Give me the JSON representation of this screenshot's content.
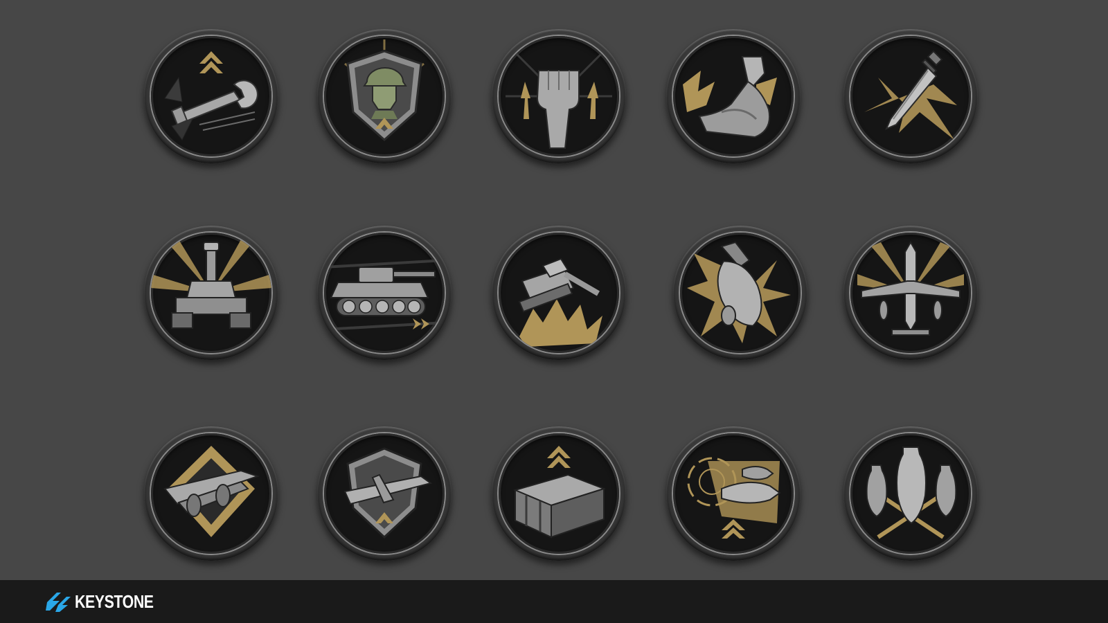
{
  "footer": {
    "brand": "KEYSTONE",
    "accent_color": "#2aa7e8"
  },
  "palette": {
    "background": "#474747",
    "gold": "#b09558",
    "steel": "#9a9a9a",
    "olive": "#7f8c64"
  },
  "icons": [
    {
      "name": "wrench-upgrade-icon",
      "motif": "wrench"
    },
    {
      "name": "infantry-shield-icon",
      "motif": "soldier-shield"
    },
    {
      "name": "raised-fist-icon",
      "motif": "fist"
    },
    {
      "name": "flexed-arm-icon",
      "motif": "arm"
    },
    {
      "name": "combat-knife-icon",
      "motif": "knife"
    },
    {
      "name": "tank-front-icon",
      "motif": "tank-front"
    },
    {
      "name": "tank-speed-icon",
      "motif": "tank-side"
    },
    {
      "name": "tank-assault-icon",
      "motif": "tank-blast"
    },
    {
      "name": "aerial-bomb-icon",
      "motif": "bomb"
    },
    {
      "name": "fighter-plane-icon",
      "motif": "fighter"
    },
    {
      "name": "heavy-bomber-icon",
      "motif": "bomber"
    },
    {
      "name": "plane-shield-icon",
      "motif": "plane-shield"
    },
    {
      "name": "supply-crate-icon",
      "motif": "crate"
    },
    {
      "name": "missile-strike-icon",
      "motif": "missile"
    },
    {
      "name": "bomb-cluster-icon",
      "motif": "bombs"
    }
  ]
}
